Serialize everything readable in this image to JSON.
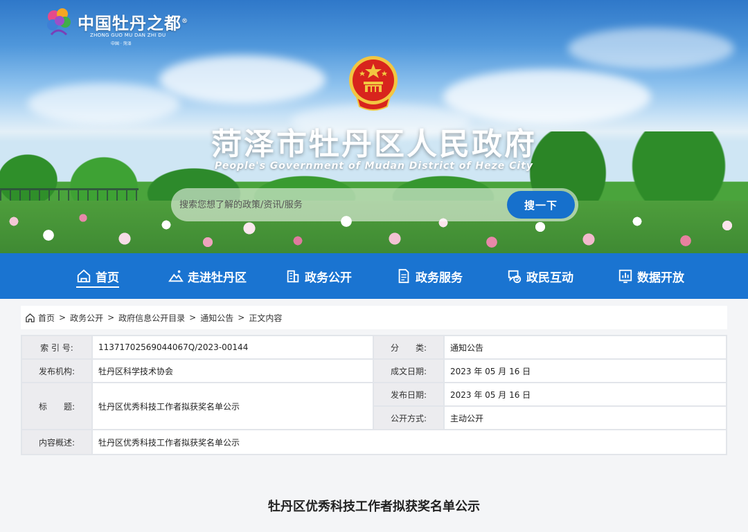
{
  "logo": {
    "title": "中国牡丹之都",
    "reg_mark": "®",
    "subtitle": "ZHONG GUO MU DAN ZHI DU",
    "location": "中国 · 菏泽"
  },
  "site": {
    "title": "菏泽市牡丹区人民政府",
    "subtitle": "People's Government of Mudan District of Heze City"
  },
  "search": {
    "placeholder": "搜索您想了解的政策/资讯/服务",
    "button_label": "搜一下"
  },
  "nav": {
    "items": [
      {
        "label": "首页",
        "icon": "home-icon",
        "active": true
      },
      {
        "label": "走进牡丹区",
        "icon": "landscape-icon"
      },
      {
        "label": "政务公开",
        "icon": "building-icon"
      },
      {
        "label": "政务服务",
        "icon": "document-icon"
      },
      {
        "label": "政民互动",
        "icon": "chat-icon"
      },
      {
        "label": "数据开放",
        "icon": "chart-icon"
      }
    ]
  },
  "breadcrumb": {
    "items": [
      "首页",
      "政务公开",
      "政府信息公开目录",
      "通知公告",
      "正文内容"
    ],
    "separator": ">"
  },
  "meta": {
    "index_label": "索 引 号:",
    "index_value": "11371702569044067Q/2023-00144",
    "category_label": "分　　类:",
    "category_value": "通知公告",
    "publisher_label": "发布机构:",
    "publisher_value": "牡丹区科学技术协会",
    "written_label": "成文日期:",
    "written_value": "2023 年 05 月 16 日",
    "title_label": "标　　题:",
    "title_value": "牡丹区优秀科技工作者拟获奖名单公示",
    "published_label": "发布日期:",
    "published_value": "2023 年 05 月 16 日",
    "open_label": "公开方式:",
    "open_value": "主动公开",
    "summary_label": "内容概述:",
    "summary_value": "牡丹区优秀科技工作者拟获奖名单公示"
  },
  "article": {
    "title": "牡丹区优秀科技工作者拟获奖名单公示"
  },
  "colors": {
    "nav_bg": "#1a74d1",
    "search_button": "#1670cc",
    "emblem_red": "#d8241d",
    "emblem_gold": "#f2c641"
  }
}
